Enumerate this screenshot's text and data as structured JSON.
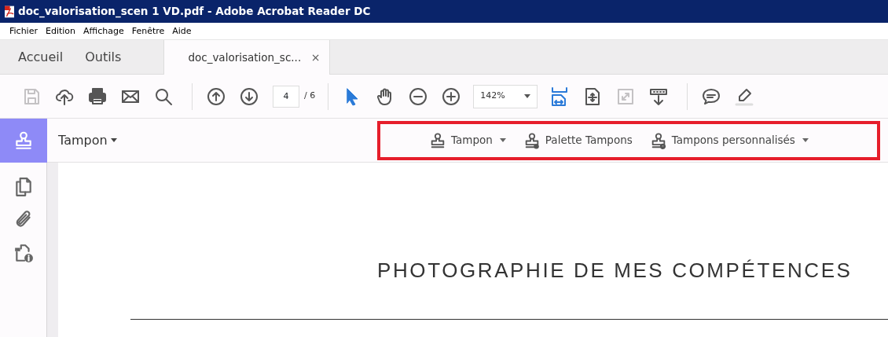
{
  "window": {
    "title": "doc_valorisation_scen 1 VD.pdf - Adobe Acrobat Reader DC"
  },
  "menu": [
    "Fichier",
    "Edition",
    "Affichage",
    "Fenêtre",
    "Aide"
  ],
  "tabs": [
    {
      "label": "Accueil",
      "kind": "nav",
      "selected": false
    },
    {
      "label": "Outils",
      "kind": "nav",
      "selected": false
    },
    {
      "label": "doc_valorisation_sc...",
      "kind": "document",
      "selected": true,
      "close": "×"
    }
  ],
  "toolbar": {
    "tools": [
      {
        "kind": "save",
        "disabled": true,
        "selected": false
      },
      {
        "kind": "upload",
        "disabled": false,
        "selected": false
      },
      {
        "kind": "print",
        "disabled": false,
        "selected": false
      },
      {
        "kind": "email",
        "disabled": false,
        "selected": false
      },
      {
        "kind": "search",
        "disabled": false,
        "selected": false
      },
      {
        "kind": "separator"
      },
      {
        "kind": "page-up",
        "disabled": false,
        "selected": false
      },
      {
        "kind": "page-down",
        "disabled": false,
        "selected": false
      },
      {
        "kind": "page-field",
        "value": "4",
        "total": "/ 6"
      },
      {
        "kind": "separator"
      },
      {
        "kind": "select",
        "disabled": false,
        "selected": true
      },
      {
        "kind": "hand",
        "disabled": false,
        "selected": false
      },
      {
        "kind": "zoom-out",
        "disabled": false,
        "selected": false
      },
      {
        "kind": "zoom-in",
        "disabled": false,
        "selected": false
      },
      {
        "kind": "zoom-field",
        "value": "142%"
      },
      {
        "kind": "fit-width",
        "disabled": false,
        "selected": true
      },
      {
        "kind": "fit-page",
        "disabled": false,
        "selected": false
      },
      {
        "kind": "full-screen",
        "disabled": true,
        "selected": false
      },
      {
        "kind": "read-mode",
        "disabled": false,
        "selected": false
      },
      {
        "kind": "separator"
      },
      {
        "kind": "comment",
        "disabled": false,
        "selected": false
      },
      {
        "kind": "highlight",
        "disabled": false,
        "selected": false
      }
    ]
  },
  "stamp_bar": {
    "title": "Tampon",
    "highlighted": true,
    "items": [
      {
        "label": "Tampon",
        "kind": "stamp",
        "dropdown": true
      },
      {
        "label": "Palette Tampons",
        "kind": "palette",
        "dropdown": false
      },
      {
        "label": "Tampons personnalisés",
        "kind": "custom",
        "dropdown": true
      }
    ]
  },
  "sidebar": {
    "items": [
      {
        "kind": "pages"
      },
      {
        "kind": "attachments"
      },
      {
        "kind": "properties"
      }
    ]
  },
  "document": {
    "heading": "PHOTOGRAPHIE DE MES COMPÉTENCES"
  }
}
